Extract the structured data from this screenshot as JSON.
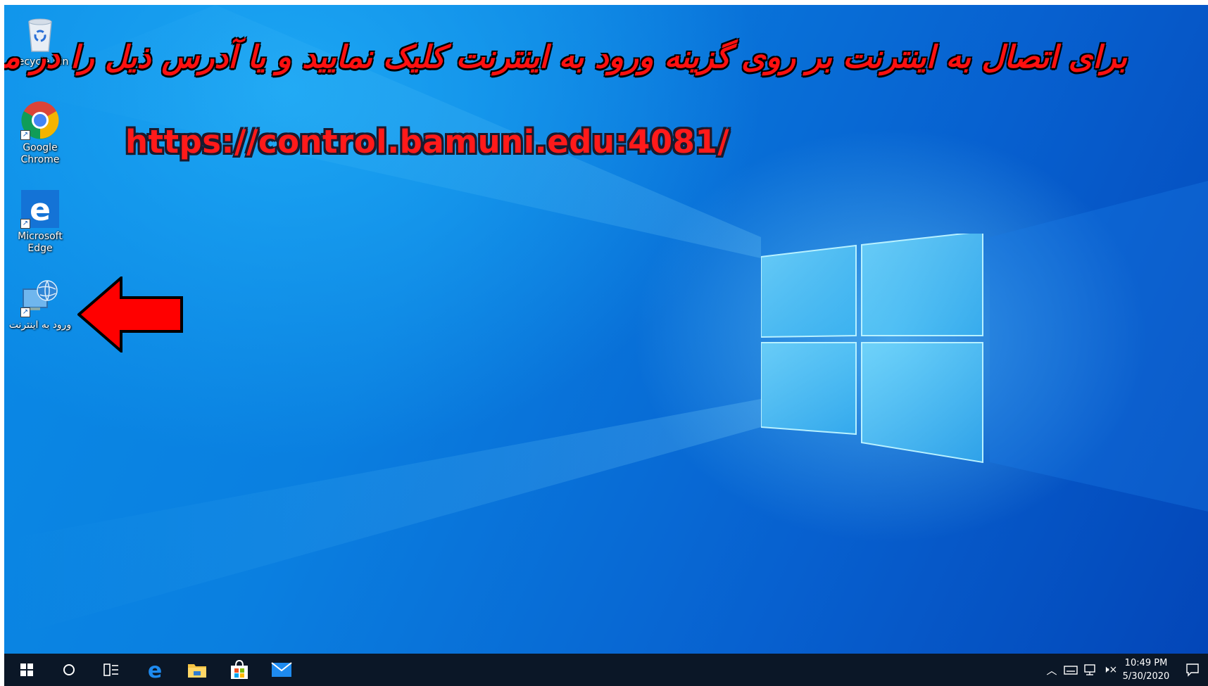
{
  "desktop": {
    "icons": [
      {
        "label": "Recycle Bin",
        "icon": "recycle-bin-icon"
      },
      {
        "label": "Google Chrome",
        "icon": "chrome-icon"
      },
      {
        "label": "Microsoft Edge",
        "icon": "edge-icon"
      },
      {
        "label": "ورود به اینترنت",
        "icon": "internet-login-icon"
      }
    ],
    "overlay": {
      "persian_instruction": "برای اتصال به اینترنت بر روی گزینه ورود به اینترنت کلیک نمایید و یا آدرس ذیل را در مرورگر خود وارد نمایید",
      "url": "https://control.bamuni.edu:4081/",
      "arrow_color": "#ff0000"
    }
  },
  "taskbar": {
    "pinned": [
      "start-icon",
      "search-icon",
      "task-view-icon",
      "edge-icon",
      "file-explorer-icon",
      "store-icon",
      "mail-icon"
    ],
    "tray": {
      "time": "10:49 PM",
      "date": "5/30/2020"
    }
  },
  "colors": {
    "taskbar_bg": "#0b1727",
    "wallpaper_accent": "#0a7fe0",
    "overlay_text": "#ff1010"
  }
}
